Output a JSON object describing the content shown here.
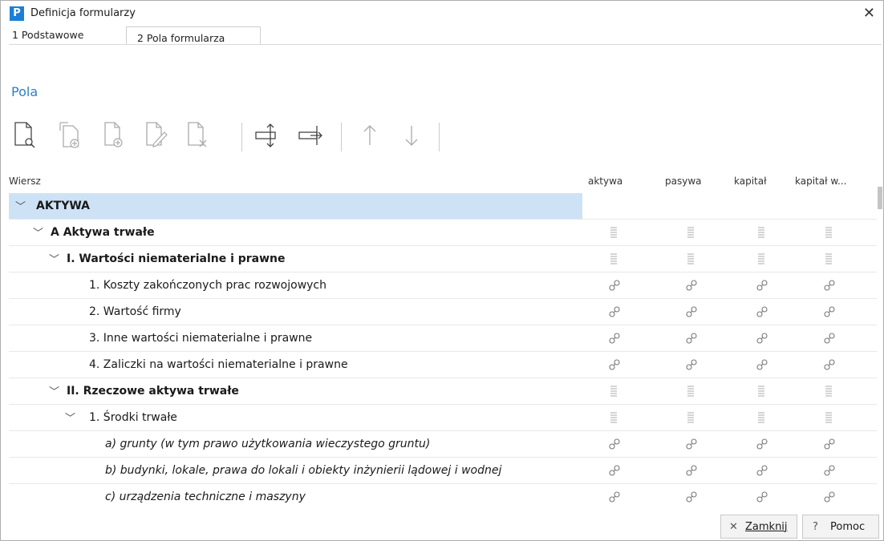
{
  "window": {
    "title": "Definicja formularzy",
    "app_logo": "P"
  },
  "tabs": [
    {
      "label": "1 Podstawowe",
      "active": false
    },
    {
      "label": "2 Pola formularza",
      "active": true
    }
  ],
  "section_title": "Pola",
  "toolbar": {
    "buttons": [
      {
        "icon": "document-preview-icon",
        "enabled": true
      },
      {
        "icon": "document-add-child-icon",
        "enabled": false
      },
      {
        "icon": "document-add-icon",
        "enabled": false
      },
      {
        "icon": "document-edit-icon",
        "enabled": false
      },
      {
        "icon": "document-delete-icon",
        "enabled": false
      },
      {
        "icon": "expand-rows-icon",
        "enabled": true
      },
      {
        "icon": "expand-level-icon",
        "enabled": true
      },
      {
        "icon": "arrow-up-icon",
        "enabled": false
      },
      {
        "icon": "arrow-down-icon",
        "enabled": false
      }
    ]
  },
  "grid": {
    "columns": [
      "Wiersz",
      "aktywa",
      "pasywa",
      "kapitał",
      "kapitał w..."
    ],
    "rows": [
      {
        "label": "AKTYWA",
        "level": 0,
        "expanded": true,
        "bold": true,
        "italic": false,
        "selected": true,
        "cell_icon": "none"
      },
      {
        "label": "A Aktywa trwałe",
        "level": 1,
        "expanded": true,
        "bold": true,
        "italic": false,
        "selected": false,
        "cell_icon": "stack-icon"
      },
      {
        "label": "I. Wartości niematerialne i prawne",
        "level": 2,
        "expanded": true,
        "bold": true,
        "italic": false,
        "selected": false,
        "cell_icon": "stack-icon"
      },
      {
        "label": "1. Koszty zakończonych prac rozwojowych",
        "level": 3,
        "expanded": null,
        "bold": false,
        "italic": false,
        "selected": false,
        "cell_icon": "link-icon"
      },
      {
        "label": "2. Wartość firmy",
        "level": 3,
        "expanded": null,
        "bold": false,
        "italic": false,
        "selected": false,
        "cell_icon": "link-icon"
      },
      {
        "label": "3. Inne wartości niematerialne i prawne",
        "level": 3,
        "expanded": null,
        "bold": false,
        "italic": false,
        "selected": false,
        "cell_icon": "link-icon"
      },
      {
        "label": "4. Zaliczki na wartości niematerialne i prawne",
        "level": 3,
        "expanded": null,
        "bold": false,
        "italic": false,
        "selected": false,
        "cell_icon": "link-icon"
      },
      {
        "label": "II. Rzeczowe aktywa trwałe",
        "level": 2,
        "expanded": true,
        "bold": true,
        "italic": false,
        "selected": false,
        "cell_icon": "stack-icon"
      },
      {
        "label": "1. Środki trwałe",
        "level": 3,
        "expanded": true,
        "bold": false,
        "italic": false,
        "selected": false,
        "cell_icon": "stack-icon"
      },
      {
        "label": "a) grunty (w tym prawo użytkowania wieczystego gruntu)",
        "level": 4,
        "expanded": null,
        "bold": false,
        "italic": true,
        "selected": false,
        "cell_icon": "link-icon"
      },
      {
        "label": "b) budynki, lokale, prawa do lokali i obiekty inżynierii lądowej i wodnej",
        "level": 4,
        "expanded": null,
        "bold": false,
        "italic": true,
        "selected": false,
        "cell_icon": "link-icon"
      },
      {
        "label": "c) urządzenia techniczne i maszyny",
        "level": 4,
        "expanded": null,
        "bold": false,
        "italic": true,
        "selected": false,
        "cell_icon": "link-icon"
      }
    ]
  },
  "footer": {
    "close_label": "Zamknij",
    "help_label": "Pomoc"
  }
}
